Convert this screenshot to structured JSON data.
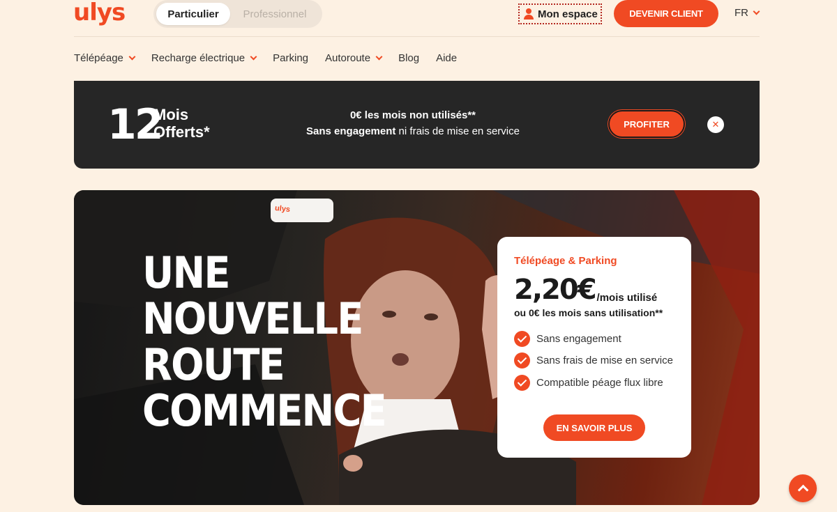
{
  "header": {
    "logo": "ulys",
    "segments": {
      "active": "Particulier",
      "inactive": "Professionnel"
    },
    "account_label": "Mon espace",
    "cta_label": "DEVENIR CLIENT",
    "lang": "FR"
  },
  "nav": {
    "items": [
      {
        "label": "Télépéage",
        "dropdown": true
      },
      {
        "label": "Recharge électrique",
        "dropdown": true
      },
      {
        "label": "Parking",
        "dropdown": false
      },
      {
        "label": "Autoroute",
        "dropdown": true
      },
      {
        "label": "Blog",
        "dropdown": false
      },
      {
        "label": "Aide",
        "dropdown": false
      }
    ]
  },
  "promo": {
    "number": "12",
    "word1": "Mois",
    "word2": "Offerts*",
    "line1": "0€ les mois non utilisés**",
    "line2_bold": "Sans engagement",
    "line2_rest": " ni frais de mise en service",
    "button": "PROFITER",
    "close_icon": "close-icon"
  },
  "hero": {
    "title_lines": [
      "UNE",
      "NOUVELLE",
      "ROUTE",
      "COMMENCE"
    ],
    "device_label": "ulys",
    "card": {
      "tag": "Télépéage & Parking",
      "price": "2,20€",
      "unit": "/mois utilisé",
      "sub": "ou 0€ les mois sans utilisation**",
      "features": [
        "Sans engagement",
        "Sans frais de mise en service",
        "Compatible péage flux libre"
      ],
      "button": "EN SAVOIR PLUS"
    }
  },
  "colors": {
    "accent": "#f04a23",
    "page_bg": "#fdf1e3",
    "banner_bg": "#262626"
  },
  "icons": {
    "account": "user-icon",
    "dropdown": "chevron-down-icon",
    "feature": "check-icon",
    "scroll": "arrow-up-icon"
  }
}
